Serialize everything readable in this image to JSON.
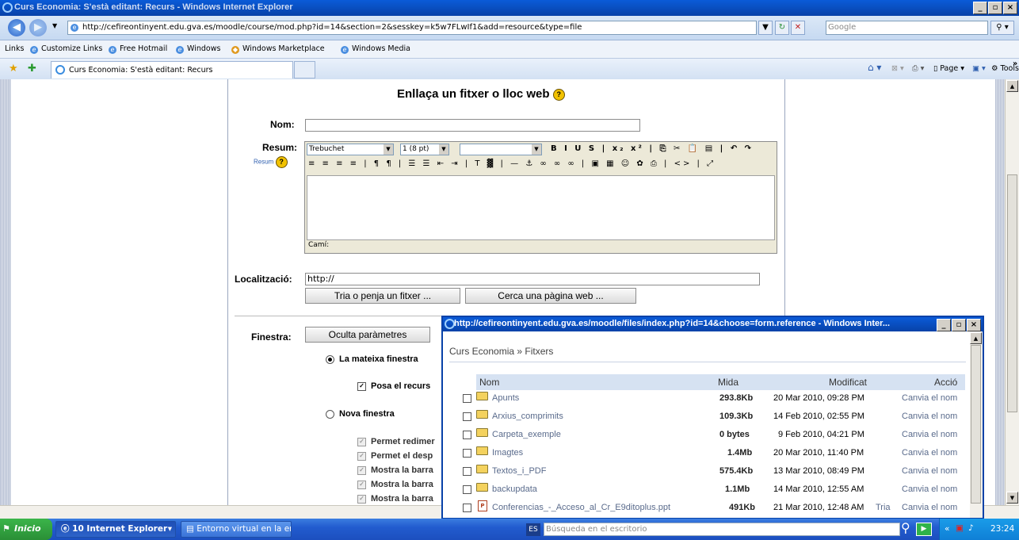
{
  "browser": {
    "window_title": "Curs Economia: S'està editant: Recurs - Windows Internet Explorer",
    "address": "http://cefireontinyent.edu.gva.es/moodle/course/mod.php?id=14&section=2&sesskey=k5w7FLwIf1&add=resource&type=file",
    "search_placeholder": "Google",
    "links_label": "Links",
    "links": [
      "Customize Links",
      "Free Hotmail",
      "Windows",
      "Windows Marketplace",
      "Windows Media"
    ],
    "tab_title": "Curs Economia: S'està editant: Recurs",
    "cmd_page": "Page",
    "cmd_tools": "Tools",
    "more": "»"
  },
  "form": {
    "heading": "Enllaça un fitxer o lloc web",
    "nom_label": "Nom:",
    "resum_label": "Resum:",
    "resum_help": "Resum",
    "editor": {
      "font": "Trebuchet",
      "size": "1 (8 pt)",
      "row1": "B I U S | x₂ x² | ⎘ ✂ 📋 ▤ | ↶ ↷",
      "row2": "≡ ≡ ≡ ≡ | ¶ ¶ | ☰ ☰ ⇤ ⇥ | T ▓ | — ⚓ ∞ ∞ ∞ | ▣ ▦ ☺ ✿ ⎙ | <> | ⤢",
      "path_label": "Camí:"
    },
    "loc_label": "Localització:",
    "loc_value": "http://",
    "btn_choose": "Tria o penja un fitxer ...",
    "btn_search": "Cerca una pàgina web ...",
    "finestra_label": "Finestra:",
    "btn_hide": "Oculta paràmetres",
    "opt_same": "La mateixa finestra",
    "chk_posa": "Posa el recurs",
    "opt_new": "Nova finestra",
    "sub_options": [
      "Permet redimer",
      "Permet el desp",
      "Mostra la barra",
      "Mostra la barra",
      "Mostra la barra"
    ]
  },
  "popup": {
    "title": "http://cefireontinyent.edu.gva.es/moodle/files/index.php?id=14&choose=form.reference - Windows Inter...",
    "breadcrumb": "Curs Economia » Fitxers",
    "headers": {
      "name": "Nom",
      "size": "Mida",
      "modified": "Modificat",
      "action": "Acció"
    },
    "rows": [
      {
        "name": "Apunts",
        "size": "293.8Kb",
        "modified": "20 Mar 2010, 09:28 PM",
        "tria": "",
        "action": "Canvia el nom",
        "type": "folder"
      },
      {
        "name": "Arxius_comprimits",
        "size": "109.3Kb",
        "modified": "14 Feb 2010, 02:55 PM",
        "tria": "",
        "action": "Canvia el nom",
        "type": "folder"
      },
      {
        "name": "Carpeta_exemple",
        "size": "0 bytes",
        "modified": "9 Feb 2010, 04:21 PM",
        "tria": "",
        "action": "Canvia el nom",
        "type": "folder"
      },
      {
        "name": "Imagtes",
        "size": "1.4Mb",
        "modified": "20 Mar 2010, 11:40 PM",
        "tria": "",
        "action": "Canvia el nom",
        "type": "folder"
      },
      {
        "name": "Textos_i_PDF",
        "size": "575.4Kb",
        "modified": "13 Mar 2010, 08:49 PM",
        "tria": "",
        "action": "Canvia el nom",
        "type": "folder"
      },
      {
        "name": "backupdata",
        "size": "1.1Mb",
        "modified": "14 Mar 2010, 12:55 AM",
        "tria": "",
        "action": "Canvia el nom",
        "type": "folder"
      },
      {
        "name": "Conferencias_-_Acceso_al_Cr_E9ditoplus.ppt",
        "size": "491Kb",
        "modified": "21 Mar 2010, 12:48 AM",
        "tria": "Tria",
        "action": "Canvia el nom",
        "type": "file"
      }
    ]
  },
  "taskbar": {
    "start": "Inicio",
    "items": [
      "10 Internet Explorer",
      "Entorno virtual en la ens..."
    ],
    "lang": "ES",
    "search_placeholder": "Búsqueda en el escritorio",
    "time": "23:24"
  }
}
